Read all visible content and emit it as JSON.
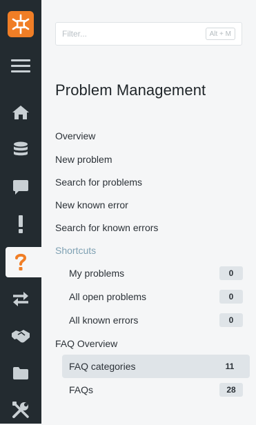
{
  "search": {
    "placeholder": "Filter...",
    "shortcut": "Alt + M"
  },
  "page": {
    "title": "Problem Management"
  },
  "nav": {
    "links": [
      "Overview",
      "New problem",
      "Search for problems",
      "New known error",
      "Search for known errors"
    ],
    "shortcuts_label": "Shortcuts",
    "shortcuts": [
      {
        "label": "My problems",
        "count": "0"
      },
      {
        "label": "All open problems",
        "count": "0"
      },
      {
        "label": "All known errors",
        "count": "0"
      }
    ],
    "faq_overview": "FAQ Overview",
    "faq_items": [
      {
        "label": "FAQ categories",
        "count": "11"
      },
      {
        "label": "FAQs",
        "count": "28"
      }
    ]
  },
  "rail": {
    "icons": [
      "logo-icon",
      "menu-icon",
      "home-icon",
      "database-icon",
      "chat-icon",
      "exclamation-icon",
      "question-icon",
      "arrows-exchange-icon",
      "handshake-icon",
      "folder-icon",
      "tools-icon"
    ],
    "active": "question-icon",
    "accent_color": "#f07e26",
    "icon_color": "#c9d0d4"
  }
}
